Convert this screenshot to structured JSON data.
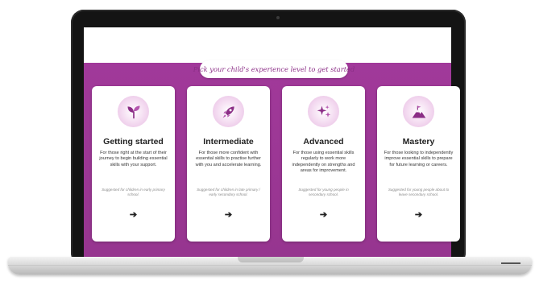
{
  "heading": "Pick your child's experience level to get started",
  "cards": [
    {
      "icon": "sprout-icon",
      "title": "Getting started",
      "description": "For those right at the start of their journey to begin building essential skills with your support.",
      "note": "Suggested for children in early primary school.",
      "arrow": "➔"
    },
    {
      "icon": "rocket-icon",
      "title": "Intermediate",
      "description": "For those more confident with essential skills to practise further with you and accelerate learning.",
      "note": "Suggested for children in late primary / early secondary school.",
      "arrow": "➔"
    },
    {
      "icon": "sparkles-icon",
      "title": "Advanced",
      "description": "For those using essential skills regularly to work more independently on strengths and areas for improvement.",
      "note": "Suggested for young people in secondary school.",
      "arrow": "➔"
    },
    {
      "icon": "mountain-flag-icon",
      "title": "Mastery",
      "description": "For those looking to independently improve essential skills to prepare for future learning or careers.",
      "note": "Suggested for young people about to leave secondary school.",
      "arrow": "➔"
    }
  ],
  "colors": {
    "band": "#a1399a",
    "accent": "#8b2e86",
    "icon_bg": "#f3d9f0"
  }
}
